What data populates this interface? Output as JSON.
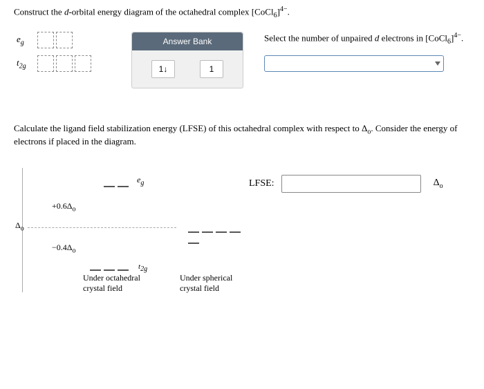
{
  "question1_prefix": "Construct the ",
  "question1_d": "d",
  "question1_mid": "-orbital energy diagram of the octahedral complex [CoCl",
  "question1_sub6": "6",
  "question1_close": "]",
  "question1_charge": "4−",
  "question1_dot": ".",
  "orbitals": {
    "eg_label": "e",
    "eg_sub": "g",
    "t2g_label": "t",
    "t2g_sub": "2g"
  },
  "answer_bank": {
    "title": "Answer Bank",
    "tile_paired": "1↓",
    "tile_single": "1"
  },
  "question2_prefix": "Select the number of unpaired ",
  "question2_d": "d",
  "question2_mid": " electrons in [CoCl",
  "question2_sub6": "6",
  "question2_close": "]",
  "question2_charge": "4−",
  "question2_dot": ".",
  "lfse_question_a": "Calculate the ligand field stabilization energy (LFSE) of this octahedral complex with respect to Δ",
  "lfse_question_sub": "o",
  "lfse_question_b": ". Consider the energy of electrons if placed in the diagram.",
  "diagram": {
    "eg_label": "e",
    "eg_sub": "g",
    "plus": "+0.6Δ",
    "plus_sub": "o",
    "minus": "−0.4Δ",
    "minus_sub": "o",
    "delta_axis": "Δ",
    "delta_axis_sub": "o",
    "t2g_label": "t",
    "t2g_sub": "2g",
    "col1_line1": "Under octahedral",
    "col1_line2": "crystal field",
    "col2_line1": "Under spherical",
    "col2_line2": "crystal field"
  },
  "lfse_label": "LFSE:",
  "delta_unit": "Δ",
  "delta_unit_sub": "o"
}
